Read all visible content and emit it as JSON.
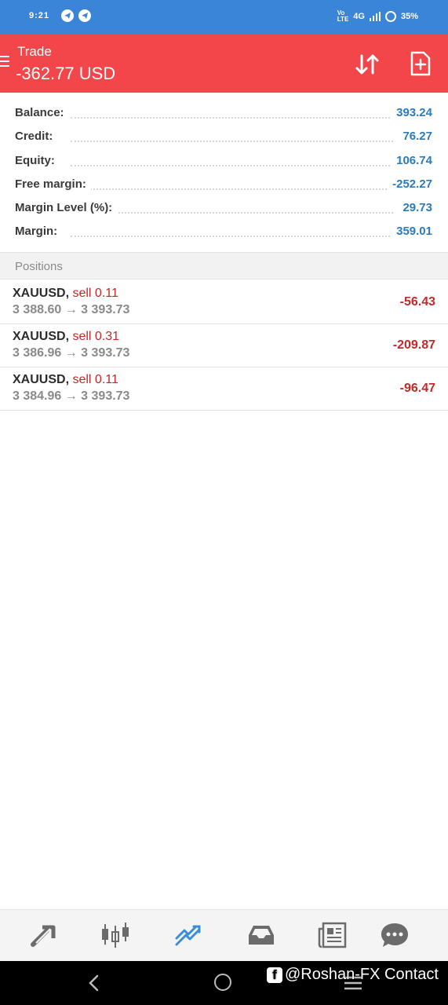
{
  "status_bar": {
    "time": "9:21",
    "network": "4G",
    "battery": "35%"
  },
  "header": {
    "title": "Trade",
    "subtitle": "-362.77 USD",
    "accent_color": "#f2464a"
  },
  "account": {
    "rows": [
      {
        "label": "Balance:",
        "value": "393.24"
      },
      {
        "label": "Credit:",
        "value": "76.27"
      },
      {
        "label": "Equity:",
        "value": "106.74"
      },
      {
        "label": "Free margin:",
        "value": "-252.27"
      },
      {
        "label": "Margin Level (%):",
        "value": "29.73"
      },
      {
        "label": "Margin:",
        "value": "359.01"
      }
    ]
  },
  "positions": {
    "header": "Positions",
    "items": [
      {
        "symbol": "XAUUSD,",
        "side": "sell 0.11",
        "prices": "3 388.60 → 3 393.73",
        "profit": "-56.43"
      },
      {
        "symbol": "XAUUSD,",
        "side": "sell 0.31",
        "prices": "3 386.96 → 3 393.73",
        "profit": "-209.87"
      },
      {
        "symbol": "XAUUSD,",
        "side": "sell 0.11",
        "prices": "3 384.96 → 3 393.73",
        "profit": "-96.47"
      }
    ]
  },
  "tabs": [
    {
      "icon": "quotes-arrows-icon"
    },
    {
      "icon": "chart-candles-icon"
    },
    {
      "icon": "trade-icon",
      "active": true
    },
    {
      "icon": "history-inbox-icon"
    },
    {
      "icon": "news-icon"
    },
    {
      "icon": "messages-icon"
    }
  ],
  "watermark": "@Roshan-FX Contact"
}
